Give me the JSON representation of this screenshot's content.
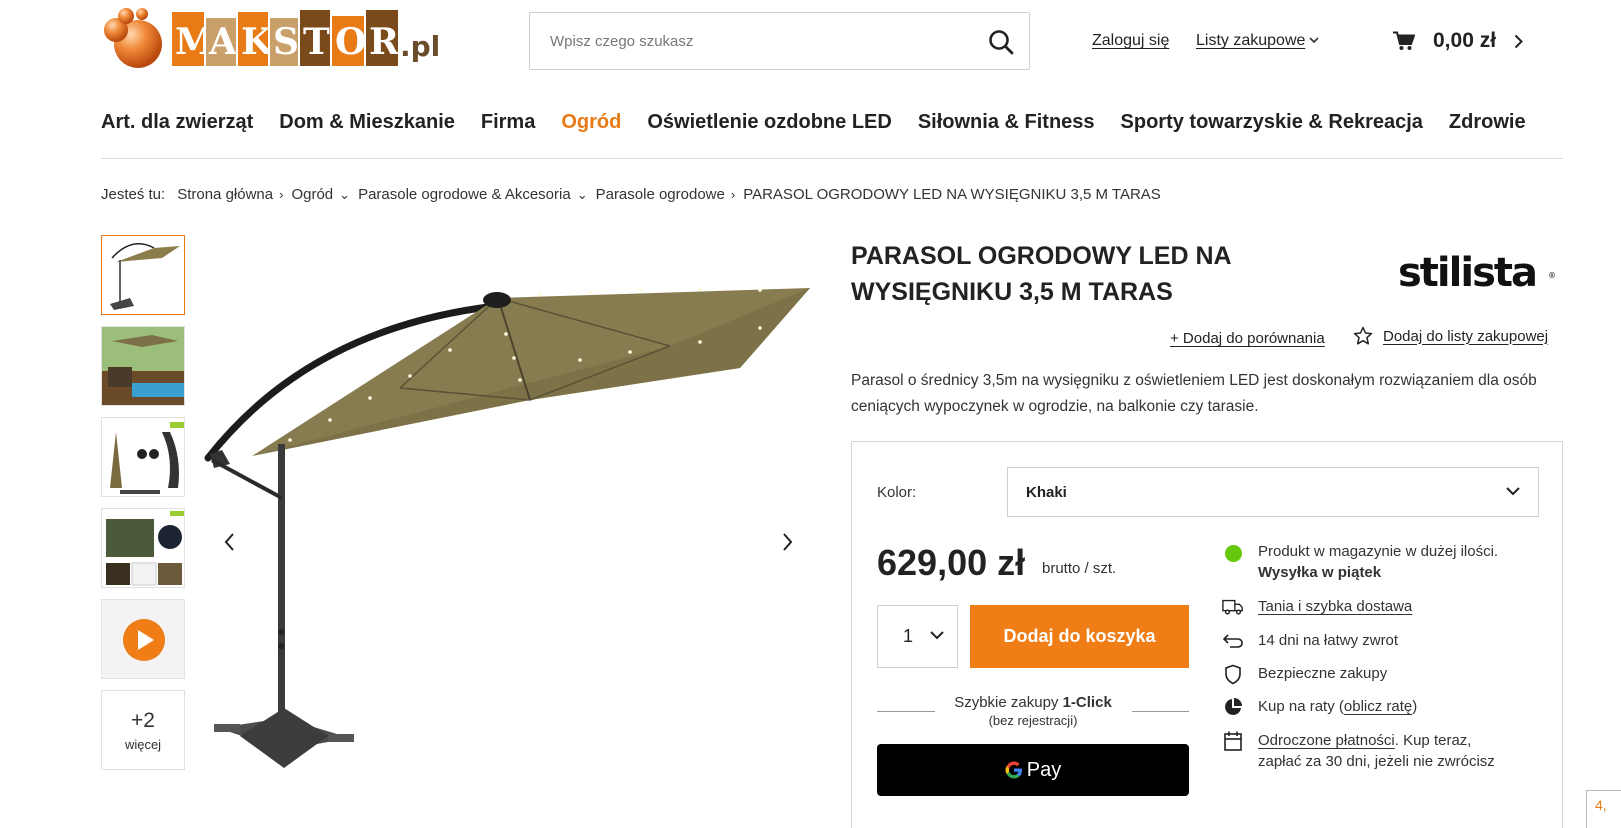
{
  "header": {
    "logo_text": "MAKSTOR.pl",
    "search_placeholder": "Wpisz czego szukasz",
    "login_label": "Zaloguj się",
    "lists_label": "Listy zakupowe",
    "cart_amount": "0,00 zł"
  },
  "categories": [
    {
      "label": "Art. dla zwierząt",
      "active": false
    },
    {
      "label": "Dom & Mieszkanie",
      "active": false
    },
    {
      "label": "Firma",
      "active": false
    },
    {
      "label": "Ogród",
      "active": true
    },
    {
      "label": "Oświetlenie ozdobne LED",
      "active": false
    },
    {
      "label": "Siłownia & Fitness",
      "active": false
    },
    {
      "label": "Sporty towarzyskie & Rekreacja",
      "active": false
    },
    {
      "label": "Zdrowie",
      "active": false
    }
  ],
  "breadcrumb": {
    "lead": "Jesteś tu:",
    "items": [
      "Strona główna",
      "Ogród",
      "Parasole ogrodowe & Akcesoria",
      "Parasole ogrodowe",
      "PARASOL OGRODOWY LED NA WYSIĘGNIKU 3,5 M TARAS"
    ]
  },
  "gallery": {
    "more_count": "+2",
    "more_label": "więcej"
  },
  "product": {
    "title": "PARASOL OGRODOWY LED NA WYSIĘGNIKU 3,5 M TARAS",
    "brand": "stilista",
    "compare_label": "+ Dodaj do porównania",
    "add_to_list_label": "Dodaj do listy zakupowej",
    "description": "Parasol o średnicy 3,5m na wysięgniku z oświetleniem LED jest doskonałym rozwiązaniem dla osób ceniących wypoczynek w ogrodzie, na balkonie czy tarasie.",
    "color_label": "Kolor:",
    "color_value": "Khaki",
    "price": "629,00 zł",
    "price_unit": "brutto / szt.",
    "quantity": "1",
    "add_to_cart_label": "Dodaj do koszyka",
    "oneclick_prefix": "Szybkie zakupy ",
    "oneclick_bold": "1-Click",
    "oneclick_sub": "(bez rejestracji)",
    "gpay_label": "Pay"
  },
  "features": {
    "stock_line1": "Produkt w magazynie w dużej ilości.",
    "stock_line2": "Wysyłka w piątek",
    "delivery": "Tania i szybka dostawa",
    "returns": "14 dni na łatwy zwrot",
    "safe": "Bezpieczne zakupy",
    "installments_prefix": "Kup na raty (",
    "installments_link": "oblicz ratę",
    "installments_suffix": ")",
    "deferred_link": "Odroczone płatności",
    "deferred_text": ". Kup teraz, zapłać za 30 dni, jeżeli nie zwrócisz"
  },
  "corner_text": "4,",
  "colors": {
    "accent": "#f07d16",
    "stock_green": "#63c90a"
  }
}
